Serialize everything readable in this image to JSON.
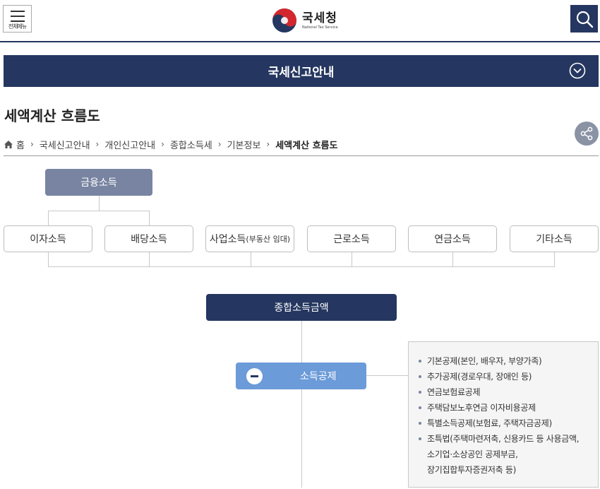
{
  "header": {
    "menu_label": "전체메뉴",
    "logo_ko": "국세청",
    "logo_en": "National Tax Service"
  },
  "banner": {
    "title": "국세신고안내"
  },
  "page_title": "세액계산 흐름도",
  "breadcrumb": {
    "home": "홈",
    "items": [
      "국세신고안내",
      "개인신고안내",
      "종합소득세",
      "기본정보"
    ],
    "current": "세액계산 흐름도"
  },
  "diagram": {
    "financial_income": "금융소득",
    "income_types": [
      {
        "label": "이자소득",
        "sub": ""
      },
      {
        "label": "배당소득",
        "sub": ""
      },
      {
        "label": "사업소득",
        "sub": "(부동산 임대)"
      },
      {
        "label": "근로소득",
        "sub": ""
      },
      {
        "label": "연금소득",
        "sub": ""
      },
      {
        "label": "기타소득",
        "sub": ""
      }
    ],
    "total_income": "종합소득금액",
    "deduction": "소득공제",
    "deduction_items": [
      "기본공제(본인, 배우자, 부양가족)",
      "추가공제(경로우대, 장애인 등)",
      "연금보험료공제",
      "주택담보노후연금 이자비용공제",
      "특별소득공제(보험료, 주택자금공제)",
      "조특법(주택마련저축, 신용카드 등 사용금액,",
      "소기업·소상공인 공제부금,",
      "장기집합투자증권저축 등)"
    ]
  },
  "colors": {
    "navy": "#253760",
    "slate": "#7884a1",
    "blue": "#6b9bd8"
  }
}
